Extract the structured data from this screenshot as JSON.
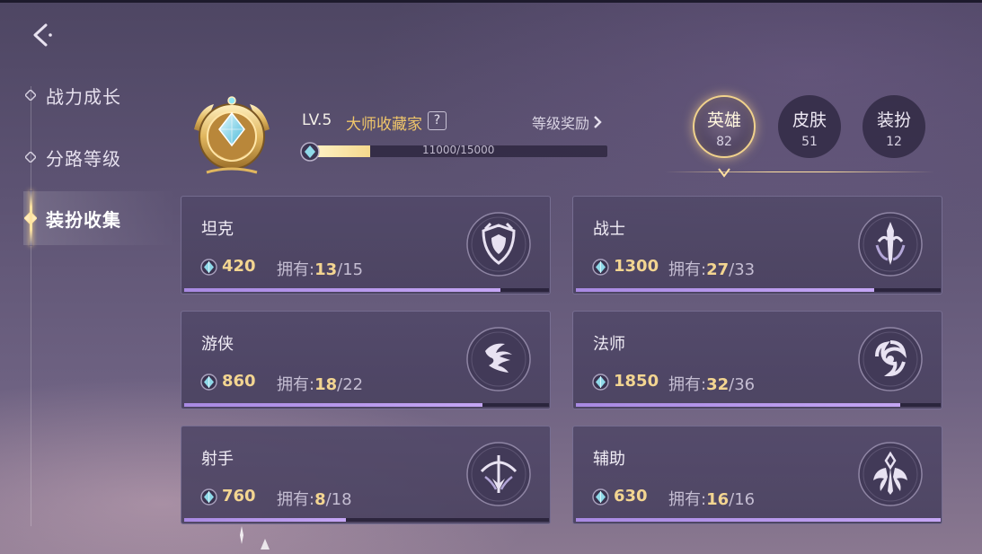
{
  "sidebar": {
    "items": [
      {
        "label": "战力成长",
        "active": false
      },
      {
        "label": "分路等级",
        "active": false
      },
      {
        "label": "装扮收集",
        "active": true
      }
    ]
  },
  "header": {
    "level": "LV.5",
    "title": "大师收藏家",
    "help": "?",
    "reward_label": "等级奖励",
    "xp_text": "11000/15000",
    "xp_fraction": 0.2
  },
  "tabs": [
    {
      "label": "英雄",
      "count": "82",
      "active": true
    },
    {
      "label": "皮肤",
      "count": "51",
      "active": false
    },
    {
      "label": "装扮",
      "count": "12",
      "active": false
    }
  ],
  "cards": [
    {
      "name": "坦克",
      "points": "420",
      "own_label": "拥有:",
      "owned": "13",
      "total": "/15",
      "progress": 0.867,
      "icon": "tank-shield-icon"
    },
    {
      "name": "战士",
      "points": "1300",
      "own_label": "拥有:",
      "owned": "27",
      "total": "/33",
      "progress": 0.818,
      "icon": "warrior-sword-icon"
    },
    {
      "name": "游侠",
      "points": "860",
      "own_label": "拥有:",
      "owned": "18",
      "total": "/22",
      "progress": 0.818,
      "icon": "ranger-wave-icon"
    },
    {
      "name": "法师",
      "points": "1850",
      "own_label": "拥有:",
      "owned": "32",
      "total": "/36",
      "progress": 0.889,
      "icon": "mage-swirl-icon"
    },
    {
      "name": "射手",
      "points": "760",
      "own_label": "拥有:",
      "owned": "8",
      "total": "/18",
      "progress": 0.444,
      "icon": "marksman-bow-icon"
    },
    {
      "name": "辅助",
      "points": "630",
      "own_label": "拥有:",
      "owned": "16",
      "total": "/16",
      "progress": 1.0,
      "icon": "support-wings-icon"
    }
  ],
  "colors": {
    "accent_gold": "#f3d591",
    "progress_purple": "#b596ec",
    "title_gold": "#f0c66a"
  }
}
